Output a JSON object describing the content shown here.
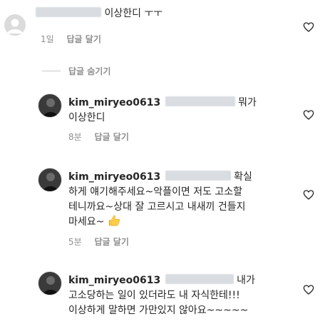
{
  "colors": {
    "text": "#262626",
    "meta": "#8e8e8e",
    "heart_stroke": "#262626",
    "redaction": "#d9dde2"
  },
  "comment_top": {
    "text": "이상한디 ㅜㅜ",
    "time": "1일",
    "reply": "답글 달기",
    "icon": "like-heart-icon"
  },
  "hide_replies": "답글 숨기기",
  "replies": [
    {
      "username": "kim_miryeo0613",
      "lines": [
        "뭐가",
        "이상한디"
      ],
      "time": "8분",
      "reply": "답글 달기"
    },
    {
      "username": "kim_miryeo0613",
      "lines": [
        "확실",
        "하게 얘기해주세요~악플이면 저도 고소할",
        "테니까요~상대 잘 고르시고 내새끼 건들지",
        "마세요~"
      ],
      "emoji": "thumbs-up-emoji",
      "time": "5분",
      "reply": "답글 달기"
    },
    {
      "username": "kim_miryeo0613",
      "lines": [
        "내가",
        "고소당하는 일이 있더라도 내 자식한테!!!",
        "이상하게 말하면 가만있지 않아요~~~~~"
      ]
    }
  ]
}
